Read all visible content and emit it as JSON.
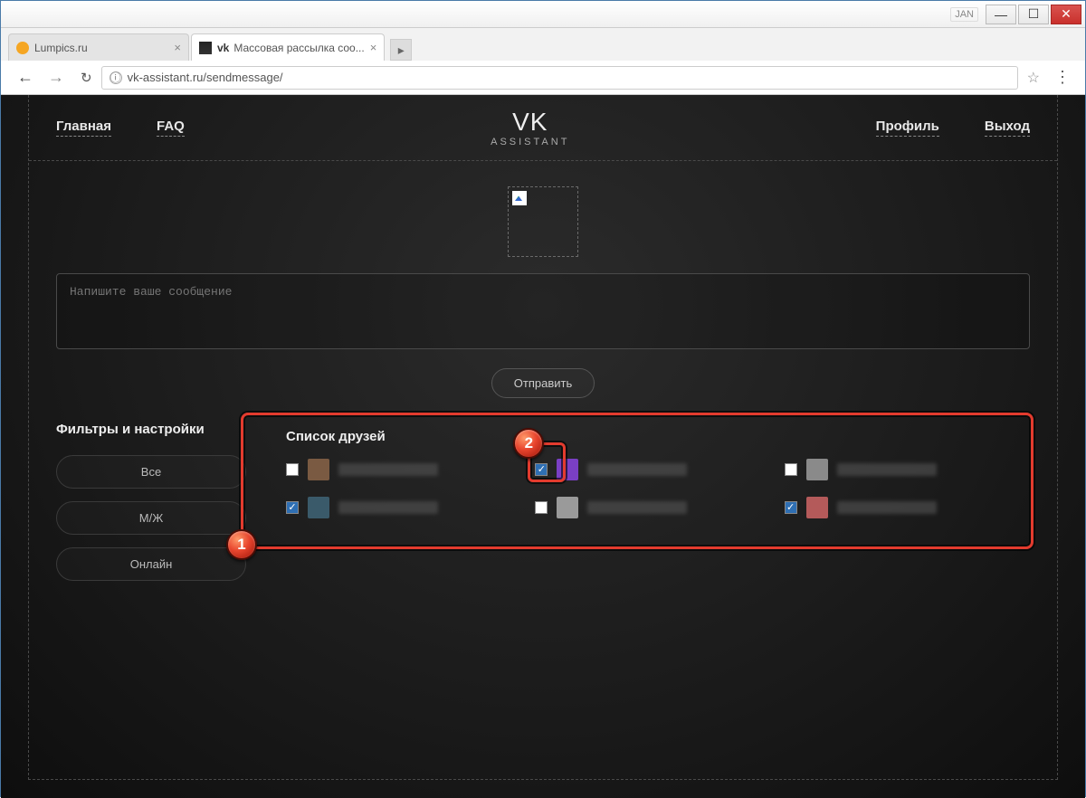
{
  "window": {
    "lang_badge": "JAN",
    "minimize": "—",
    "maximize": "☐",
    "close": "✕"
  },
  "tabs": [
    {
      "title": "Lumpics.ru",
      "active": false,
      "favicon": "orange"
    },
    {
      "title": "Массовая рассылка соо...",
      "prefix": "vk",
      "active": true,
      "favicon": "vk"
    }
  ],
  "newtab_label": "▸",
  "nav": {
    "back": "←",
    "forward": "→",
    "reload": "↻",
    "info": "ⓘ",
    "url": "vk-assistant.ru/sendmessage/",
    "star": "☆",
    "menu": "⋮"
  },
  "header": {
    "left": [
      "Главная",
      "FAQ"
    ],
    "logo_big": "VK",
    "logo_small": "ASSISTANT",
    "right": [
      "Профиль",
      "Выход"
    ]
  },
  "message_placeholder": "Напишите ваше сообщение",
  "send_label": "Отправить",
  "filters": {
    "title": "Фильтры и настройки",
    "buttons": [
      "Все",
      "М/Ж",
      "Онлайн"
    ]
  },
  "friends": {
    "title": "Список друзей",
    "items": [
      {
        "checked": false,
        "avatar_color": "#7a5a42"
      },
      {
        "checked": true,
        "avatar_color": "#7a3fc4",
        "annotated": true
      },
      {
        "checked": false,
        "avatar_color": "#8a8a8a"
      },
      {
        "checked": true,
        "avatar_color": "#3a5a6a"
      },
      {
        "checked": false,
        "avatar_color": "#9a9a9a"
      },
      {
        "checked": true,
        "avatar_color": "#b45a5a"
      }
    ]
  },
  "annotations": {
    "badge1": "1",
    "badge2": "2"
  }
}
